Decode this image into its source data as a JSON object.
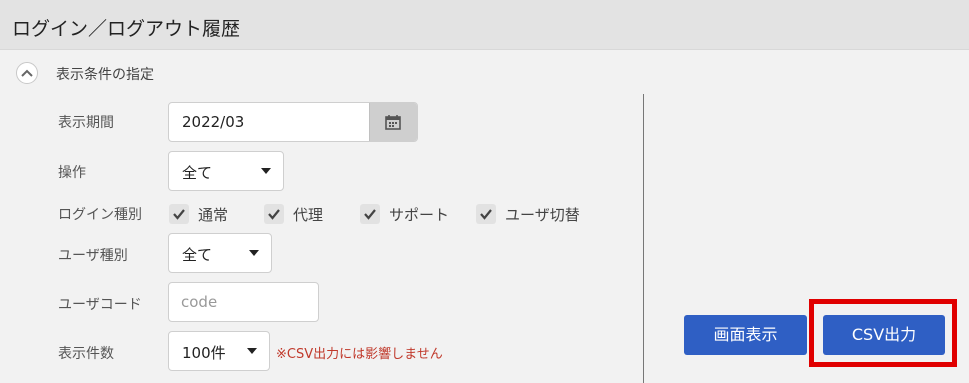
{
  "header": {
    "title": "ログイン／ログアウト履歴"
  },
  "filter": {
    "section_label": "表示条件の指定",
    "period": {
      "label": "表示期間",
      "value": "2022/03"
    },
    "operation": {
      "label": "操作",
      "value": "全て"
    },
    "login_type": {
      "label": "ログイン種別",
      "options": [
        {
          "label": "通常",
          "checked": true
        },
        {
          "label": "代理",
          "checked": true
        },
        {
          "label": "サポート",
          "checked": true
        },
        {
          "label": "ユーザ切替",
          "checked": true
        }
      ]
    },
    "user_type": {
      "label": "ユーザ種別",
      "value": "全て"
    },
    "user_code": {
      "label": "ユーザコード",
      "placeholder": "code"
    },
    "count": {
      "label": "表示件数",
      "value": "100件",
      "note": "※CSV出力には影響しません"
    }
  },
  "actions": {
    "display_label": "画面表示",
    "csv_label": "CSV出力"
  },
  "colors": {
    "button_blue": "#2f5fc4",
    "highlight_red": "#e00000",
    "note_red": "#c0392b"
  }
}
